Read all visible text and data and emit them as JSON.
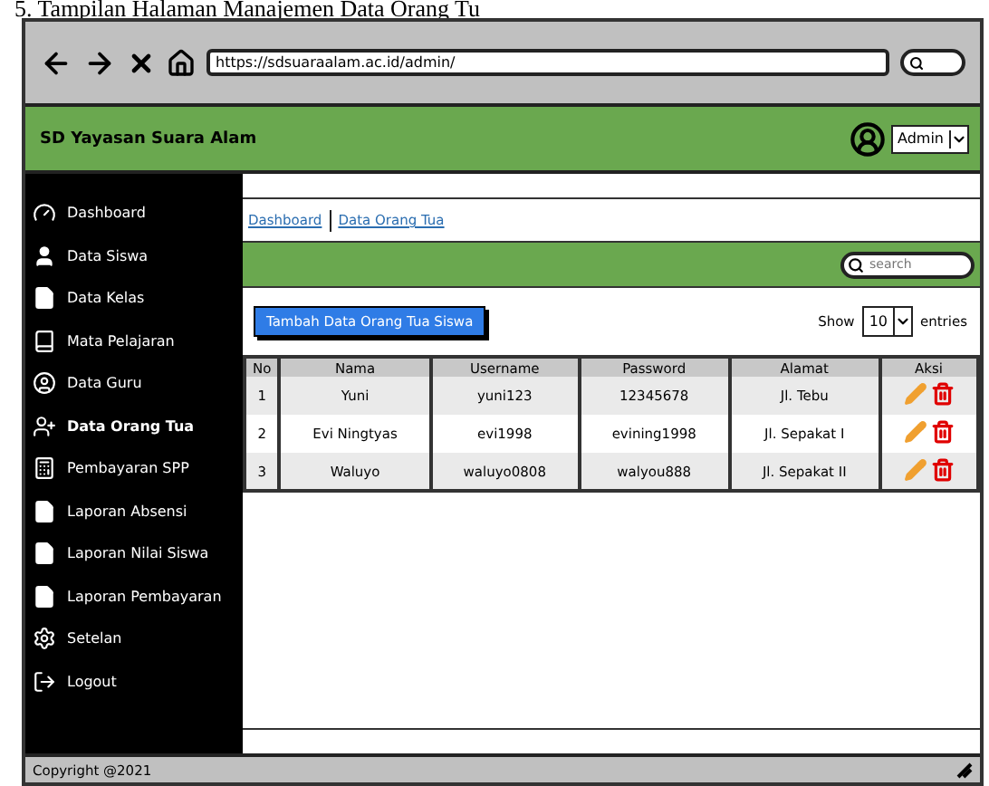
{
  "caption": "5. Tampilan Halaman Manajemen Data Orang Tu",
  "browser": {
    "url": "https://sdsuaraalam.ac.id/admin/"
  },
  "header": {
    "title": "SD Yayasan Suara Alam",
    "user": "Admin"
  },
  "sidebar": {
    "items": [
      {
        "label": "Dashboard",
        "selected": false
      },
      {
        "label": "Data Siswa",
        "selected": false
      },
      {
        "label": "Data Kelas",
        "selected": false
      },
      {
        "label": "Mata Pelajaran",
        "selected": false
      },
      {
        "label": "Data Guru",
        "selected": false
      },
      {
        "label": "Data Orang Tua",
        "selected": true
      },
      {
        "label": "Pembayaran SPP",
        "selected": false
      },
      {
        "label": "Laporan Absensi",
        "selected": false
      },
      {
        "label": "Laporan Nilai Siswa",
        "selected": false
      },
      {
        "label": "Laporan Pembayaran",
        "selected": false
      },
      {
        "label": "Setelan",
        "selected": false
      },
      {
        "label": "Logout",
        "selected": false
      }
    ]
  },
  "breadcrumb": [
    "Dashboard",
    "Data Orang Tua"
  ],
  "search": {
    "placeholder": "search"
  },
  "add_button": "Tambah Data Orang Tua Siswa",
  "entries": {
    "show": "Show",
    "value": "10",
    "suffix": "entries"
  },
  "table": {
    "columns": [
      "No",
      "Nama",
      "Username",
      "Password",
      "Alamat",
      "Aksi"
    ],
    "rows": [
      [
        "1",
        "Yuni",
        "yuni123",
        "12345678",
        "Jl. Tebu"
      ],
      [
        "2",
        "Evi Ningtyas",
        "evi1998",
        "evining1998",
        "Jl. Sepakat I"
      ],
      [
        "3",
        "Waluyo",
        "waluyo0808",
        "walyou888",
        "Jl. Sepakat II"
      ]
    ]
  },
  "footer": "Copyright @2021"
}
